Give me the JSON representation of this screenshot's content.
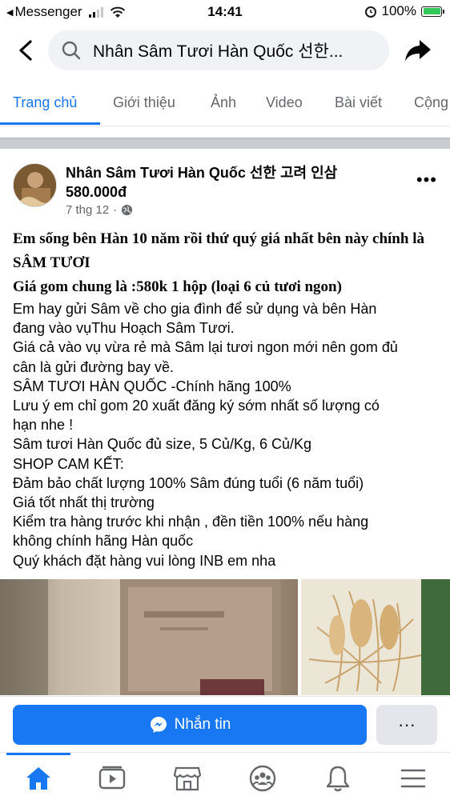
{
  "status_bar": {
    "carrier": "Messenger",
    "time": "14:41",
    "battery": "100%",
    "battery_level": 1.0
  },
  "top_bar": {
    "search_text": "Nhân Sâm Tươi Hàn Quốc 선한..."
  },
  "tabs": [
    {
      "label": "Trang chủ"
    },
    {
      "label": "Giới thiệu"
    },
    {
      "label": "Ảnh"
    },
    {
      "label": "Video"
    },
    {
      "label": "Bài viết"
    },
    {
      "label": "Cộng"
    }
  ],
  "post": {
    "author": "Nhân Sâm Tươi Hàn Quốc 선한 고려 인삼 580.000đ",
    "date": "7 thg 12",
    "separator": "·",
    "bold_lines": [
      "Em sống bên Hàn 10 năm rồi thứ quý giá nhất bên này chính là",
      "SÂM TƯƠI",
      "Giá gom chung là :580k 1 hộp (loại 6 củ tươi ngon)"
    ],
    "lines": [
      "Em hay gửi Sâm về cho gia đình để sử dụng và bên Hàn",
      "đang vào vụThu Hoạch Sâm Tươi.",
      "Giá cả vào vụ vừa rẻ mà Sâm lại tươi ngon mới nên gom đủ",
      "cân là gửi đường bay về.",
      "SÂM TƯƠI HÀN QUỐC -Chính hãng 100%",
      "Lưu ý em chỉ gom 20 xuất đăng ký sớm nhất số lượng có",
      "hạn nhe !",
      "Sâm tươi Hàn Quốc đủ size, 5 Củ/Kg, 6 Củ/Kg",
      "SHOP CAM KẾT:",
      "Đảm bảo chất lượng 100% Sâm đúng tuổi (6 năm tuổi)",
      "Giá tốt nhất thị trường",
      "Kiểm tra hàng trước khi nhận , đền tiền 100% nếu hàng",
      "không chính hãng Hàn quốc",
      "Quý khách đặt hàng vui lòng INB em nha"
    ]
  },
  "actions": {
    "message_label": "Nhắn tin",
    "more_label": "···"
  },
  "colors": {
    "accent": "#1877f2",
    "secondary_text": "#65676b"
  },
  "bottom_nav": [
    {
      "icon": "home-icon"
    },
    {
      "icon": "video-icon"
    },
    {
      "icon": "marketplace-icon"
    },
    {
      "icon": "groups-icon"
    },
    {
      "icon": "notifications-icon"
    },
    {
      "icon": "menu-icon"
    }
  ]
}
